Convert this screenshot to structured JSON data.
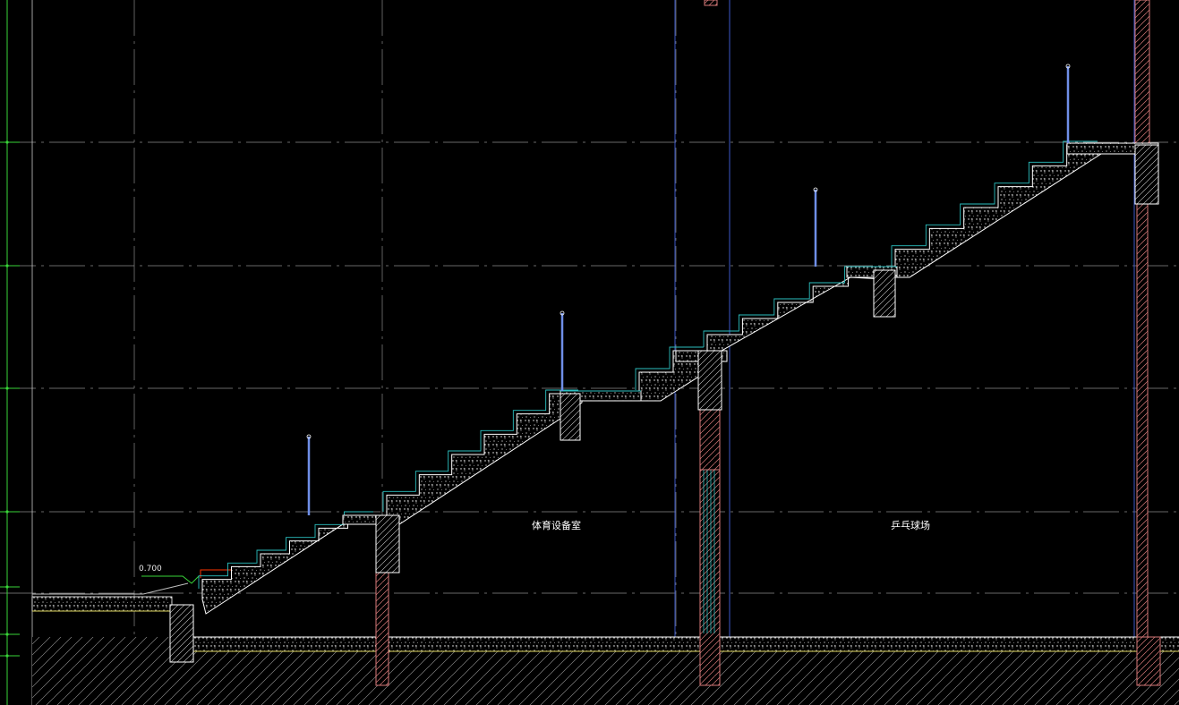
{
  "drawing": {
    "background": "#000000",
    "colors": {
      "grid": "#8a8a8a",
      "axis": "#39d439",
      "concrete": "#ffffff",
      "guardrail": "#6f8fe8",
      "finish_line": "#2bbfbf",
      "column": "#d97a7a",
      "ground_line": "#e0d860",
      "level_marker": "#39d439",
      "marker_red": "#ff3300"
    },
    "level_text": "0.700",
    "room_labels": [
      "体育设备室",
      "乒乓球场"
    ]
  }
}
